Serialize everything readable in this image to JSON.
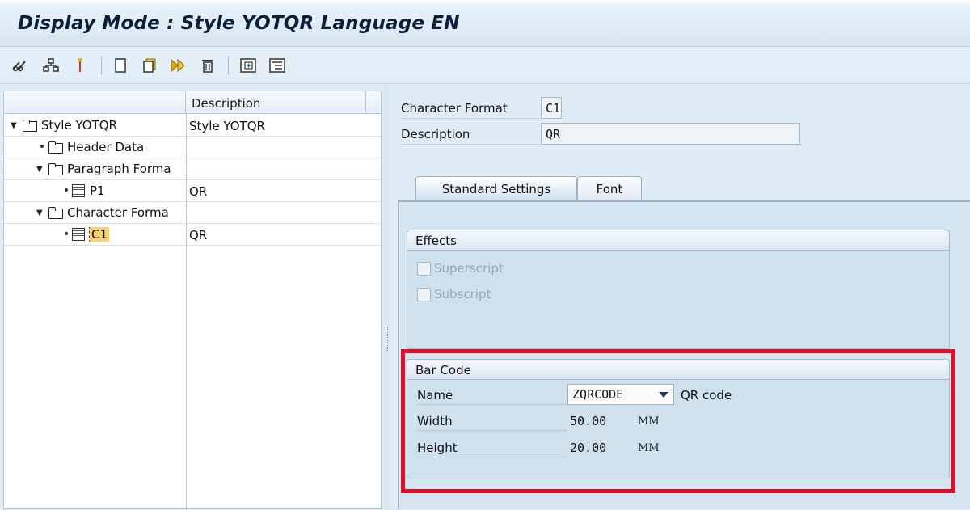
{
  "window": {
    "title": "Display Mode : Style YOTQR Language EN"
  },
  "toolbar": {
    "icons": [
      "glasses-icon",
      "hierarchy-icon",
      "pin-icon",
      "new-document-icon",
      "copy-icon",
      "forward-icon",
      "delete-icon",
      "expand-icon",
      "collapse-icon"
    ]
  },
  "tree": {
    "column_header": "Description",
    "rows": [
      {
        "label": "Style YOTQR",
        "description": "Style YOTQR",
        "type": "folder",
        "expanded": true
      },
      {
        "label": "Header Data",
        "description": "",
        "type": "folder"
      },
      {
        "label": "Paragraph Forma",
        "description": "",
        "type": "folder",
        "expanded": true
      },
      {
        "label": "P1",
        "description": "QR",
        "type": "doc"
      },
      {
        "label": "Character Forma",
        "description": "",
        "type": "folder",
        "expanded": true
      },
      {
        "label": "C1",
        "description": "QR",
        "type": "doc",
        "selected": true
      }
    ]
  },
  "form": {
    "character_format_label": "Character Format",
    "character_format_value": "C1",
    "description_label": "Description",
    "description_value": "QR"
  },
  "tabs": [
    {
      "label": "Standard Settings",
      "active": true
    },
    {
      "label": "Font",
      "active": false
    }
  ],
  "effects": {
    "title": "Effects",
    "superscript_label": "Superscript",
    "subscript_label": "Subscript"
  },
  "barcode": {
    "title": "Bar Code",
    "name_label": "Name",
    "name_value": "ZQRCODE",
    "name_text": "QR code",
    "width_label": "Width",
    "width_value": "50.00",
    "width_unit": "MM",
    "height_label": "Height",
    "height_value": "20.00",
    "height_unit": "MM"
  },
  "colors": {
    "highlight": "#e0102c",
    "selected": "#fbd26b"
  }
}
